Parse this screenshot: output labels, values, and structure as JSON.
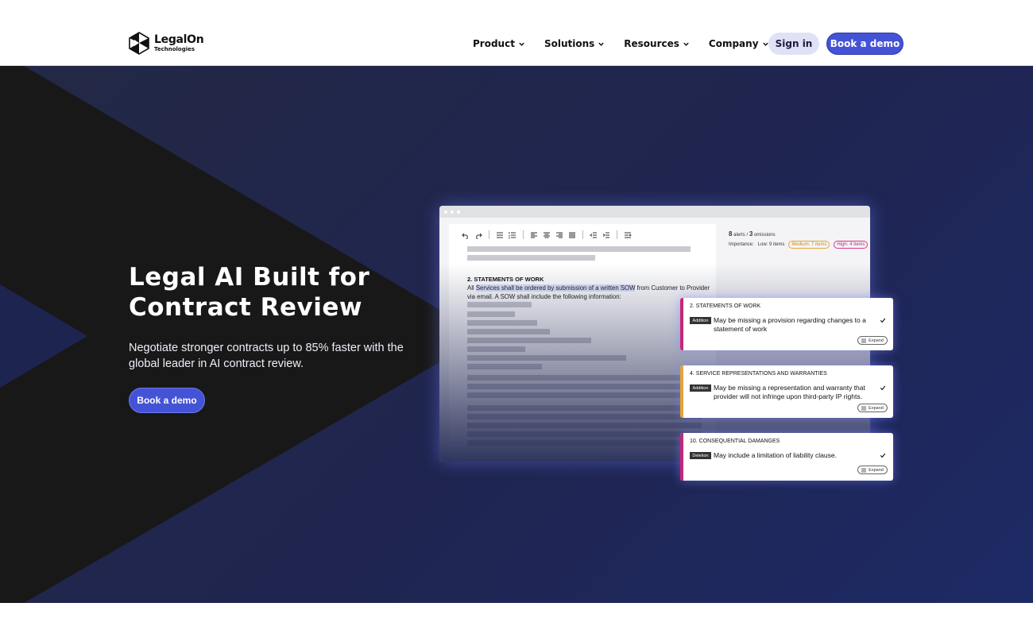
{
  "brand": {
    "name": "LegalOn",
    "sub": "Technologies"
  },
  "nav": {
    "items": [
      {
        "label": "Product"
      },
      {
        "label": "Solutions"
      },
      {
        "label": "Resources"
      },
      {
        "label": "Company"
      }
    ]
  },
  "header": {
    "signin_label": "Sign in",
    "demo_label": "Book a demo"
  },
  "hero": {
    "title": "Legal AI Built for Contract Review",
    "subtitle": "Negotiate stronger contracts up to 85% faster with the global leader in AI contract review.",
    "cta_label": "Book a demo"
  },
  "mock": {
    "doc_heading": "2. STATEMENTS OF WORK",
    "doc_text_before": "All ",
    "doc_text_highlight": "Services shall be ordered by submission of a written SOW",
    "doc_text_after": " from Customer to Provider via email. A SOW shall include the following information:",
    "alerts_count": "8",
    "alerts_label": "alerts /",
    "omissions_count": "3",
    "omissions_label": "omissions",
    "importance_label": "Importance:",
    "low_label": "Low: 9 items",
    "medium_label": "Medium: 7 items",
    "high_label": "High: 4 items"
  },
  "cards": [
    {
      "heading": "2. Statements of Work",
      "tag": "Addition",
      "message": "May be missing a provision regarding changes to a statement of work",
      "expand": "Expand",
      "stripe": "#c2287a"
    },
    {
      "heading": "4. Service Representations and Warranties",
      "tag": "Addition",
      "message": "May be missing a representation and warranty that provider will not infringe upon third-party IP rights.",
      "expand": "Expand",
      "stripe": "#e4a43a"
    },
    {
      "heading": "10. Consequential Damanges",
      "tag": "Deletion",
      "message": "May include a limitation of liability clause.",
      "expand": "Expand",
      "stripe": "#c2287a"
    }
  ],
  "icons": {
    "logo": "legalon-logo-icon",
    "chevron": "chevron-down-icon",
    "undo": "undo-icon",
    "redo": "redo-icon",
    "check": "check-icon",
    "expand": "expand-icon"
  },
  "colors": {
    "accent": "#4453d6",
    "hero_bg": "#1f2550",
    "medium": "#e4a43a",
    "high": "#c2287a"
  }
}
